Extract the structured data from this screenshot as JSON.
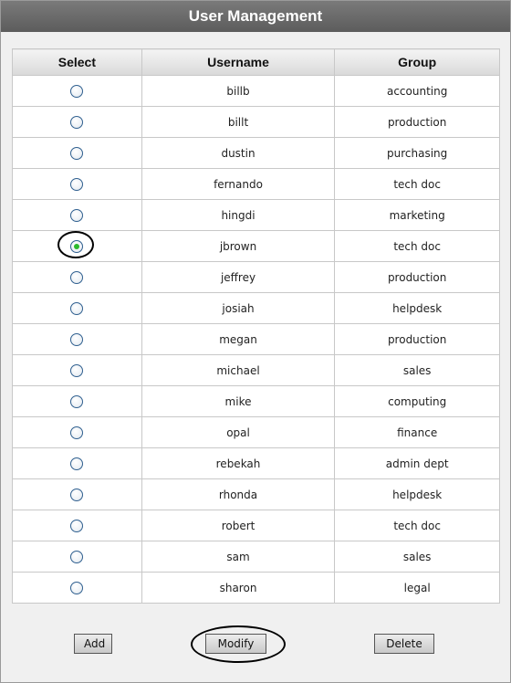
{
  "panel": {
    "title": "User Management"
  },
  "table": {
    "headers": {
      "select": "Select",
      "username": "Username",
      "group": "Group"
    },
    "rows": [
      {
        "username": "billb",
        "group": "accounting",
        "selected": false
      },
      {
        "username": "billt",
        "group": "production",
        "selected": false
      },
      {
        "username": "dustin",
        "group": "purchasing",
        "selected": false
      },
      {
        "username": "fernando",
        "group": "tech doc",
        "selected": false
      },
      {
        "username": "hingdi",
        "group": "marketing",
        "selected": false
      },
      {
        "username": "jbrown",
        "group": "tech doc",
        "selected": true
      },
      {
        "username": "jeffrey",
        "group": "production",
        "selected": false
      },
      {
        "username": "josiah",
        "group": "helpdesk",
        "selected": false
      },
      {
        "username": "megan",
        "group": "production",
        "selected": false
      },
      {
        "username": "michael",
        "group": "sales",
        "selected": false
      },
      {
        "username": "mike",
        "group": "computing",
        "selected": false
      },
      {
        "username": "opal",
        "group": "finance",
        "selected": false
      },
      {
        "username": "rebekah",
        "group": "admin dept",
        "selected": false
      },
      {
        "username": "rhonda",
        "group": "helpdesk",
        "selected": false
      },
      {
        "username": "robert",
        "group": "tech doc",
        "selected": false
      },
      {
        "username": "sam",
        "group": "sales",
        "selected": false
      },
      {
        "username": "sharon",
        "group": "legal",
        "selected": false
      }
    ]
  },
  "buttons": {
    "add": "Add",
    "modify": "Modify",
    "delete": "Delete"
  },
  "colors": {
    "title_bar": "#666666",
    "radio_selected": "#2cba2c",
    "radio_border": "#2f5f8f"
  }
}
